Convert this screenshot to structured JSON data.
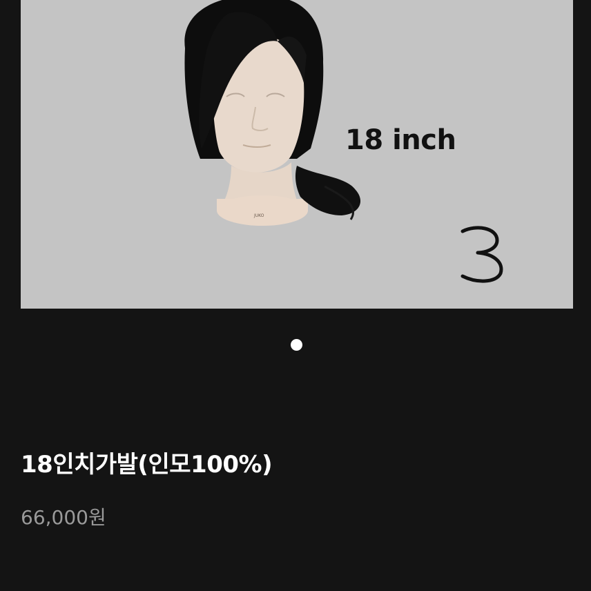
{
  "image": {
    "size_label": "18 inch",
    "number_mark": "3",
    "mannequin_brand": "JUKO",
    "background_color": "#c4c4c4"
  },
  "carousel": {
    "total_dots": 1,
    "active_index": 0
  },
  "product": {
    "title": "18인치가발(인모100%)",
    "price": "66,000원"
  },
  "colors": {
    "page_background": "#141414",
    "title": "#ffffff",
    "price": "#9a9a9a",
    "active_dot": "#ffffff"
  }
}
